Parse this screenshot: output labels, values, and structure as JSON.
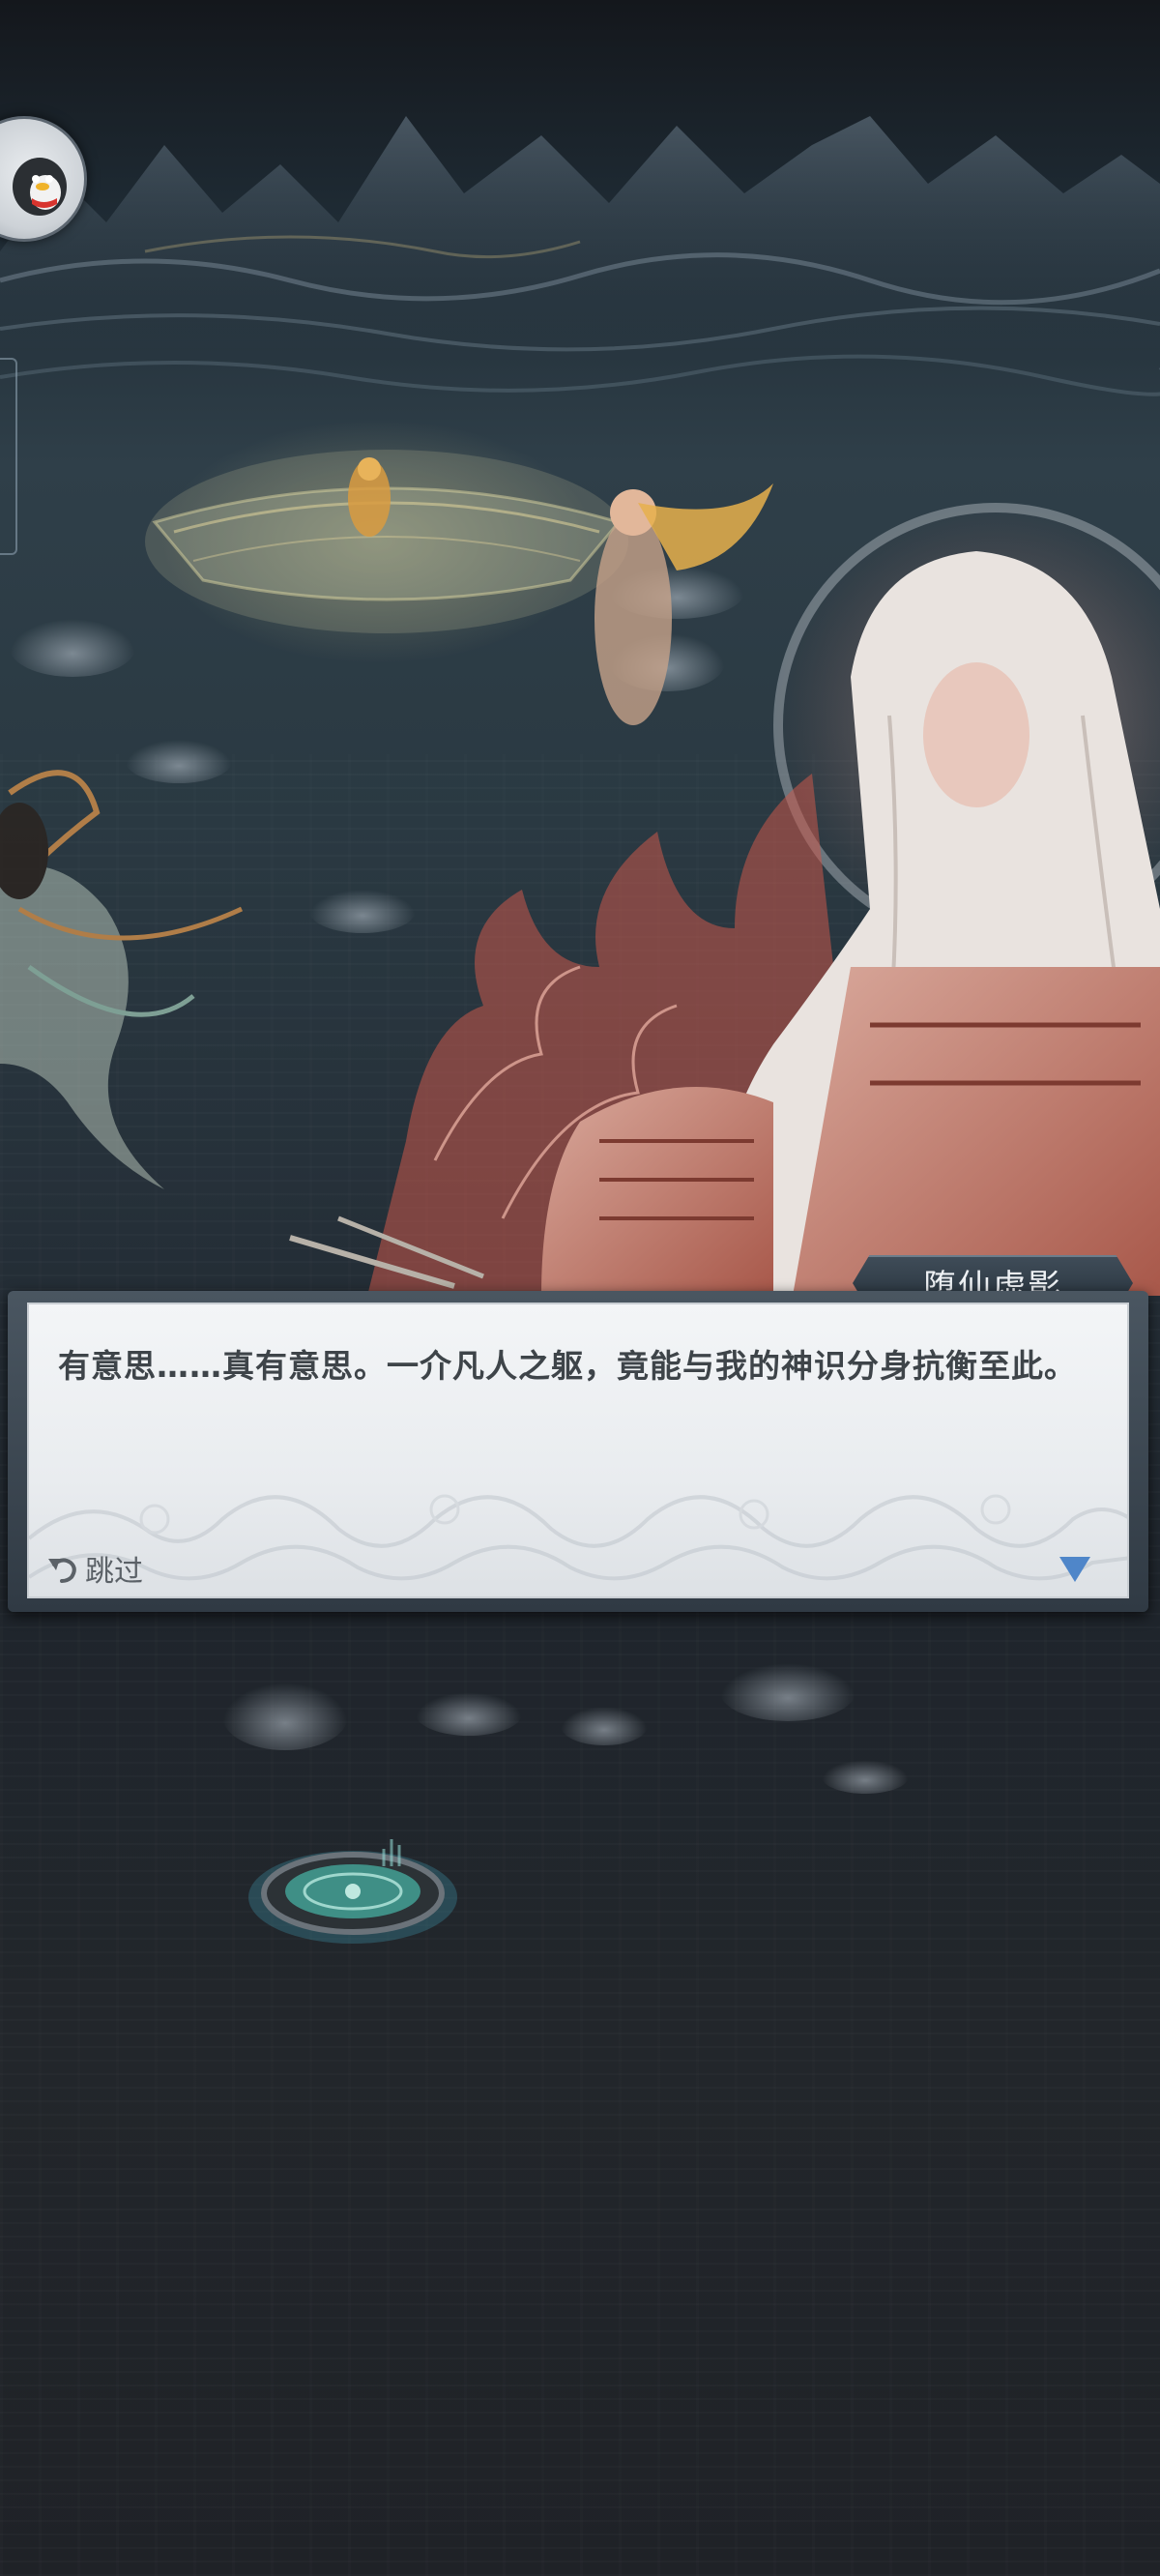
{
  "dialog": {
    "speaker_name": "堕仙虚影",
    "text": "有意思……真有意思。一介凡人之躯，竟能与我的神识分身抗衡至此。",
    "skip_label": "跳过"
  },
  "icons": {
    "skip": "undo-arrow-icon",
    "next": "down-triangle-icon",
    "avatar": "penguin-avatar-icon"
  },
  "colors": {
    "dialog_text": "#3e4449",
    "next_arrow": "#4f86c9",
    "nameplate": "#2d3842"
  }
}
